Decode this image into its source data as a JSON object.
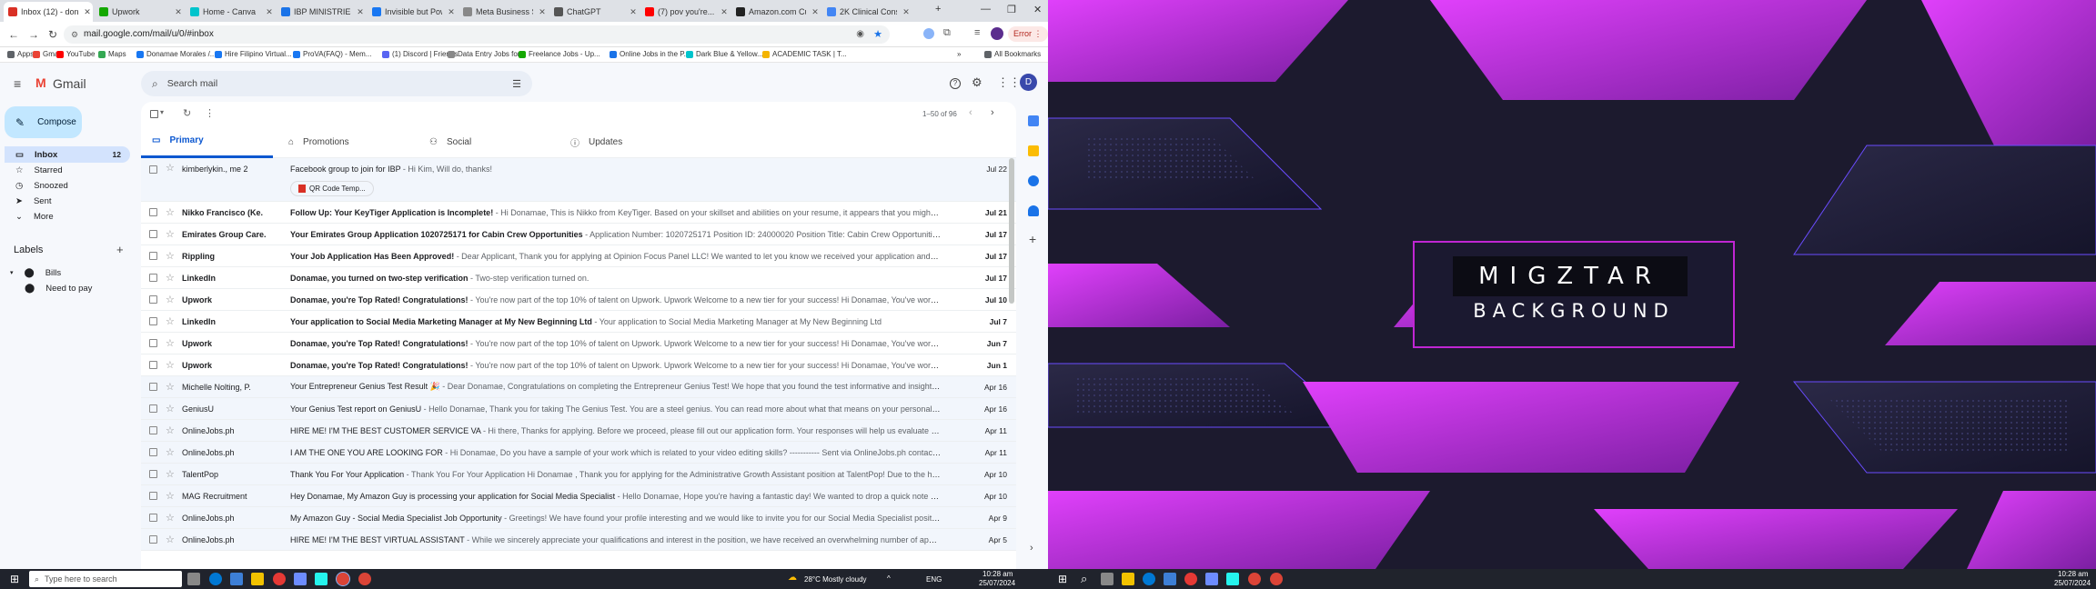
{
  "browser": {
    "tabs": [
      {
        "label": "Inbox (12) - don...",
        "color": "#d93025",
        "active": true
      },
      {
        "label": "Upwork",
        "color": "#14a800"
      },
      {
        "label": "Home - Canva",
        "color": "#00c4cc"
      },
      {
        "label": "IBP MINISTRIES I...",
        "color": "#1a73e8"
      },
      {
        "label": "Invisible but Pow...",
        "color": "#1877f2"
      },
      {
        "label": "Meta Business Su...",
        "color": "#888888"
      },
      {
        "label": "ChatGPT",
        "color": "#555555"
      },
      {
        "label": "(7) pov you're...",
        "color": "#ff0000"
      },
      {
        "label": "Amazon.com Cu...",
        "color": "#222222"
      },
      {
        "label": "2K Clinical Consu...",
        "color": "#4285f4"
      }
    ],
    "url": "mail.google.com/mail/u/0/#inbox",
    "error_label": "Error",
    "bookmarks": [
      {
        "label": "Apps",
        "color": "#5f6368"
      },
      {
        "label": "Gmail",
        "color": "#ea4335"
      },
      {
        "label": "YouTube",
        "color": "#ff0000"
      },
      {
        "label": "Maps",
        "color": "#34a853"
      },
      {
        "label": "Donamae Morales /...",
        "color": "#1877f2"
      },
      {
        "label": "Hire Filipino Virtual...",
        "color": "#1877f2"
      },
      {
        "label": "ProVA(FAQ) - Mem...",
        "color": "#1877f2"
      },
      {
        "label": "(1) Discord | Friends",
        "color": "#5865f2"
      },
      {
        "label": "Data Entry Jobs for...",
        "color": "#888888"
      },
      {
        "label": "Freelance Jobs - Up...",
        "color": "#14a800"
      },
      {
        "label": "Online Jobs in the P...",
        "color": "#1a73e8"
      },
      {
        "label": "Dark Blue & Yellow...",
        "color": "#00c4cc"
      },
      {
        "label": "ACADEMIC TASK | T...",
        "color": "#f4b400"
      }
    ],
    "all_bookmarks": "All Bookmarks"
  },
  "gmail": {
    "logo_text": "Gmail",
    "compose": "Compose",
    "search_placeholder": "Search mail",
    "avatar_letter": "D",
    "nav": [
      {
        "label": "Inbox",
        "count": "12",
        "icon": "inbox-icon",
        "selected": true
      },
      {
        "label": "Starred",
        "icon": "star-icon"
      },
      {
        "label": "Snoozed",
        "icon": "clock-icon"
      },
      {
        "label": "Sent",
        "icon": "send-icon"
      },
      {
        "label": "More",
        "icon": "chevron-down-icon"
      }
    ],
    "labels_heading": "Labels",
    "labels": [
      {
        "label": "Bills",
        "indent": false
      },
      {
        "label": "Need to pay",
        "indent": true
      }
    ],
    "pagination": "1–50 of 96",
    "categories": [
      {
        "label": "Primary",
        "active": true
      },
      {
        "label": "Promotions"
      },
      {
        "label": "Social"
      },
      {
        "label": "Updates"
      }
    ],
    "emails": [
      {
        "sender": "kimberlykin., me 2",
        "subject": "Facebook group to join for IBP",
        "snippet": " - Hi Kim, Will do, thanks!",
        "date": "Jul 22",
        "unread": false,
        "attachment": "QR Code Temp..."
      },
      {
        "sender": "Nikko Francisco (Ke.",
        "subject": "Follow Up: Your KeyTiger Application is Incomplete!",
        "snippet": " - Hi Donamae, This is Nikko from KeyTiger. Based on your skillset and abilities on your resume, it appears that you might be a VERY go...",
        "date": "Jul 21",
        "unread": true
      },
      {
        "sender": "Emirates Group Care.",
        "subject": "Your Emirates Group Application 1020725171 for Cabin Crew Opportunities",
        "snippet": " - Application Number: 1020725171 Position ID: 24000020 Position Title: Cabin Crew Opportunities Dear Don...",
        "date": "Jul 17",
        "unread": true
      },
      {
        "sender": "Rippling",
        "subject": "Your Job Application Has Been Approved!",
        "snippet": " - Dear Applicant, Thank you for applying at Opinion Focus Panel LLC! We wanted to let you know we received your application and we are deligh...",
        "date": "Jul 17",
        "unread": true
      },
      {
        "sender": "LinkedIn",
        "subject": "Donamae, you turned on two-step verification",
        "snippet": " - Two-step verification turned on.",
        "date": "Jul 17",
        "unread": true
      },
      {
        "sender": "Upwork",
        "subject": "Donamae, you're Top Rated! Congratulations!",
        "snippet": " - You're now part of the top 10% of talent on Upwork. Upwork Welcome to a new tier for your success! Hi Donamae, You've worked hard to ...",
        "date": "Jul 10",
        "unread": true
      },
      {
        "sender": "LinkedIn",
        "subject": "Your application to Social Media Marketing Manager at My New Beginning Ltd",
        "snippet": " - Your application to Social Media Marketing Manager at My New Beginning Ltd",
        "date": "Jul 7",
        "unread": true
      },
      {
        "sender": "Upwork",
        "subject": "Donamae, you're Top Rated! Congratulations!",
        "snippet": " - You're now part of the top 10% of talent on Upwork. Upwork Welcome to a new tier for your success! Hi Donamae, You've worked hard to ...",
        "date": "Jun 7",
        "unread": true
      },
      {
        "sender": "Upwork",
        "subject": "Donamae, you're Top Rated! Congratulations!",
        "snippet": " - You're now part of the top 10% of talent on Upwork. Upwork Welcome to a new tier for your success! Hi Donamae, You've worked hard to ...",
        "date": "Jun 1",
        "unread": true
      },
      {
        "sender": "Michelle Nolting, P.",
        "subject": "Your Entrepreneur Genius Test Result 🎉",
        "snippet": " - Dear Donamae, Congratulations on completing the Entrepreneur Genius Test! We hope that you found the test informative and insightful, and that ...",
        "date": "Apr 16",
        "unread": false
      },
      {
        "sender": "GeniusU",
        "subject": "Your Genius Test report on GeniusU",
        "snippet": " - Hello Donamae, Thank you for taking The Genius Test. You are a steel genius. You can read more about what that means on your personal report: Downl...",
        "date": "Apr 16",
        "unread": false
      },
      {
        "sender": "OnlineJobs.ph",
        "subject": "HIRE ME! I'M THE BEST CUSTOMER SERVICE VA",
        "snippet": " - Hi there, Thanks for applying. Before we proceed, please fill out our application form. Your responses will help us evaluate your suitability fo...",
        "date": "Apr 11",
        "unread": false
      },
      {
        "sender": "OnlineJobs.ph",
        "subject": "I AM THE ONE YOU ARE LOOKING FOR",
        "snippet": " - Hi Donamae, Do you have a sample of your work which is related to your video editing skills? ----------- Sent via OnlineJobs.ph contact form (E6273...",
        "date": "Apr 11",
        "unread": false
      },
      {
        "sender": "TalentPop",
        "subject": "Thank You For Your Application",
        "snippet": " - Thank You For Your Application Hi Donamae , Thank you for applying for the Administrative Growth Assistant position at TalentPop! Due to the high volume o...",
        "date": "Apr 10",
        "unread": false
      },
      {
        "sender": "MAG Recruitment",
        "subject": "Hey Donamae, My Amazon Guy is processing your application for Social Media Specialist",
        "snippet": " - Hello Donamae, Hope you're having a fantastic day! We wanted to drop a quick note to confirm th...",
        "date": "Apr 10",
        "unread": false
      },
      {
        "sender": "OnlineJobs.ph",
        "subject": "My Amazon Guy - Social Media Specialist Job Opportunity",
        "snippet": " - Greetings! We have found your profile interesting and we would like to invite you for our Social Media Specialist position here at ...",
        "date": "Apr 9",
        "unread": false
      },
      {
        "sender": "OnlineJobs.ph",
        "subject": "HIRE ME! I'M THE BEST VIRTUAL ASSISTANT",
        "snippet": " - While we sincerely appreciate your qualifications and interest in the position, we have received an overwhelming number of applicants and we ...",
        "date": "Apr 5",
        "unread": false
      }
    ]
  },
  "wallpaper": {
    "line1": "MIGZTAR",
    "line2": "BACKGROUND"
  },
  "taskbar": {
    "search_placeholder": "Type here to search",
    "weather": "28°C  Mostly cloudy",
    "lang": "ENG",
    "time": "10:28 am",
    "date": "25/07/2024",
    "time_right": "10:28 am",
    "date_right": "25/07/2024"
  },
  "colors": {
    "accent_blue": "#0b57d0",
    "compose_bg": "#c2e7ff",
    "wallpaper_purple": "#c026d3",
    "wallpaper_dark": "#1c1a2e"
  }
}
